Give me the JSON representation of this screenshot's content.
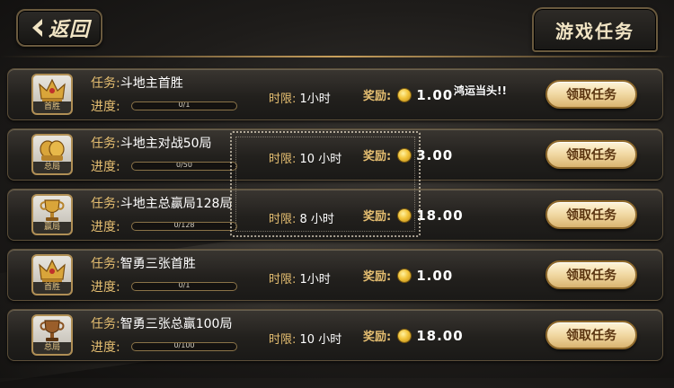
{
  "header": {
    "back_label": "返回",
    "title": "游戏任务"
  },
  "promo_text": "鸿运当头!!",
  "labels": {
    "task_prefix": "任务:",
    "progress_prefix": "进度:",
    "time_prefix": "时限:",
    "reward_prefix": "奖励:",
    "claim_button": "领取任务"
  },
  "colors": {
    "gold_accent": "#e6bf71",
    "button_text": "#5a3410",
    "coin": "#f2c43a"
  },
  "tasks": [
    {
      "name": "斗地主首胜",
      "icon": "crown-icon",
      "icon_caption": "首胜",
      "progress_text": "0/1",
      "progress_fraction": 0,
      "time_limit": "1小时",
      "reward": "1.00"
    },
    {
      "name": "斗地主对战50局",
      "icon": "crown-stack-icon",
      "icon_caption": "总局",
      "progress_text": "0/50",
      "progress_fraction": 0,
      "time_limit": "10 小时",
      "reward": "3.00"
    },
    {
      "name": "斗地主总赢局128局",
      "icon": "trophy-icon",
      "icon_caption": "赢局",
      "progress_text": "0/128",
      "progress_fraction": 0,
      "time_limit": "8 小时",
      "reward": "18.00"
    },
    {
      "name": "智勇三张首胜",
      "icon": "crown-icon",
      "icon_caption": "首胜",
      "progress_text": "0/1",
      "progress_fraction": 0,
      "time_limit": "1小时",
      "reward": "1.00"
    },
    {
      "name": "智勇三张总赢100局",
      "icon": "trophy-icon",
      "icon_caption": "总局",
      "progress_text": "0/100",
      "progress_fraction": 0,
      "time_limit": "10 小时",
      "reward": "18.00"
    }
  ]
}
